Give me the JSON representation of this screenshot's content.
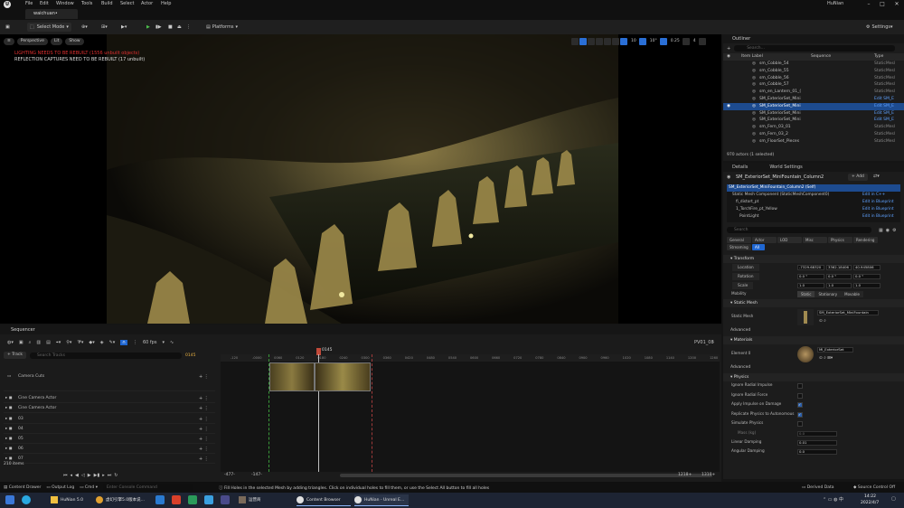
{
  "menu": {
    "items": [
      "File",
      "Edit",
      "Window",
      "Tools",
      "Build",
      "Select",
      "Actor",
      "Help"
    ],
    "user": "HuNian"
  },
  "tab": {
    "project": "waichuan•"
  },
  "toolbar": {
    "select_mode": "Select Mode",
    "platforms": "Platforms",
    "settings": "Settings"
  },
  "viewport": {
    "perspective": "Perspective",
    "lit": "Lit",
    "show": "Show",
    "warning_lighting": "LIGHTING NEEDS TO BE REBUILT (1556 unbuilt objects)",
    "warning_reflection": "REFLECTION CAPTURES NEED TO BE REBUILT (17 unbuilt)",
    "grid_snap": "10",
    "rot_snap": "10°",
    "scale_snap": "0.25",
    "cam_speed": "4"
  },
  "outliner": {
    "title": "Outliner",
    "search_placeholder": "Search...",
    "col_item": "Item Label",
    "col_sequence": "Sequence",
    "col_type": "Type",
    "rows": [
      {
        "name": "sm_Cobble_54",
        "type": "StaticMesl"
      },
      {
        "name": "sm_Cobble_55",
        "type": "StaticMesl"
      },
      {
        "name": "sm_Cobble_56",
        "type": "StaticMesl"
      },
      {
        "name": "sm_Cobble_57",
        "type": "StaticMesl"
      },
      {
        "name": "sm_en_Lantern_01_(",
        "type": "StaticMesl"
      },
      {
        "name": "SM_ExteriorSet_Mini",
        "type": "Edit SM_E"
      },
      {
        "name": "SM_ExteriorSet_Mini",
        "type": "Edit SM_E"
      },
      {
        "name": "SM_ExteriorSet_Mini",
        "type": "Edit SM_E"
      },
      {
        "name": "SM_ExteriorSet_Mini",
        "type": "Edit SM_E"
      },
      {
        "name": "sm_Fern_03_01",
        "type": "StaticMesl"
      },
      {
        "name": "sm_Fern_03_2",
        "type": "StaticMesl"
      },
      {
        "name": "sm_FloorSet_Pieces",
        "type": "StaticMesl"
      }
    ],
    "selected_index": 6,
    "footer": "970 actors (1 selected)"
  },
  "details": {
    "tab_details": "Details",
    "tab_world": "World Settings",
    "actor_name": "SM_ExteriorSet_MiniFountain_Column2",
    "add": "Add",
    "components": [
      {
        "name": "SM_ExteriorSet_MiniFountain_Column2 (Self)",
        "action": ""
      },
      {
        "name": "Static Mesh Component (StaticMeshComponent0)",
        "action": "Edit in C++"
      },
      {
        "name": "fi_distort_pt",
        "action": "Edit in Blueprint"
      },
      {
        "name": "1_TorchFire_pt_Yellow",
        "action": "Edit in Blueprint"
      },
      {
        "name": "PointLight",
        "action": "Edit in Blueprint"
      }
    ],
    "search_placeholder": "Search",
    "categories": [
      "General",
      "Actor",
      "LOD",
      "Misc",
      "Physics",
      "Rendering",
      "Streaming",
      "All"
    ],
    "transform": "Transform",
    "location_label": "Location",
    "location": [
      "-7329.68320",
      "3362.18406",
      "40.945806"
    ],
    "rotation_label": "Rotation",
    "rotation": [
      "0.0 °",
      "0.0 °",
      "0.0 °"
    ],
    "scale_label": "Scale",
    "scale": [
      "1.0",
      "1.0",
      "1.0"
    ],
    "mobility_label": "Mobility",
    "mobility": [
      "Static",
      "Stationary",
      "Movable"
    ],
    "static_mesh_section": "Static Mesh",
    "static_mesh_label": "Static Mesh",
    "static_mesh_value": "SM_ExteriorSet_MiniFountain",
    "advanced": "Advanced",
    "materials_section": "Materials",
    "element_label": "Element 0",
    "material_value": "MI_ExteriorSet",
    "physics_section": "Physics",
    "physics": [
      {
        "label": "Ignore Radial Impulse",
        "checked": false
      },
      {
        "label": "Ignore Radial Force",
        "checked": false
      },
      {
        "label": "Apply Impulse on Damage",
        "checked": true
      },
      {
        "label": "Replicate Physics to Autonomous",
        "checked": true
      },
      {
        "label": "Simulate Physics",
        "checked": false
      }
    ],
    "mass_label": "Mass (kg)",
    "mass_value": "0.0",
    "linear_damping_label": "Linear Damping",
    "linear_damping": "0.01",
    "angular_damping_label": "Angular Damping",
    "angular_damping": "0.0"
  },
  "sequencer": {
    "title": "Sequencer",
    "fps": "60 fps",
    "track": "Track",
    "search_placeholder": "Search Tracks",
    "current_frame": "0145",
    "sequence_name": "PV01_08",
    "tracks": [
      "Camera Cuts",
      "Cine Camera Actor",
      "Cine Camera Actor",
      "03",
      "04",
      "05",
      "06",
      "07"
    ],
    "item_count": "210 items",
    "range_start": "-477-",
    "range_in": "-147-",
    "range_out": "1218+",
    "range_end": "1310+",
    "ruler": [
      "-120",
      "-0000",
      "0060",
      "0120",
      "0180",
      "0240",
      "0300",
      "0360",
      "0420",
      "0480",
      "0540",
      "0600",
      "0660",
      "0720",
      "0780",
      "0840",
      "0900",
      "0960",
      "1020",
      "1080",
      "1140",
      "1200",
      "1260"
    ]
  },
  "statusbar": {
    "content_drawer": "Content Drawer",
    "output_log": "Output Log",
    "cmd": "Cmd",
    "console_placeholder": "Enter Console Command",
    "hint": "Fill Holes in the selected Mesh by adding triangles. Click on individual holes to fill them, or use the Select All button to fill all holes",
    "derived_data": "Derived Data",
    "source_control": "Source Control Off"
  },
  "taskbar": {
    "apps": [
      "HuNian 5.0",
      "虚幻引擎5.0版本说...",
      "运营商",
      "Content Browser",
      "HuNian - Unreal E..."
    ],
    "time": "14:22",
    "date": "2022/4/7"
  },
  "colors": {
    "accent": "#1f66d1",
    "warning": "#e03030",
    "selection": "#1d4b8f"
  }
}
